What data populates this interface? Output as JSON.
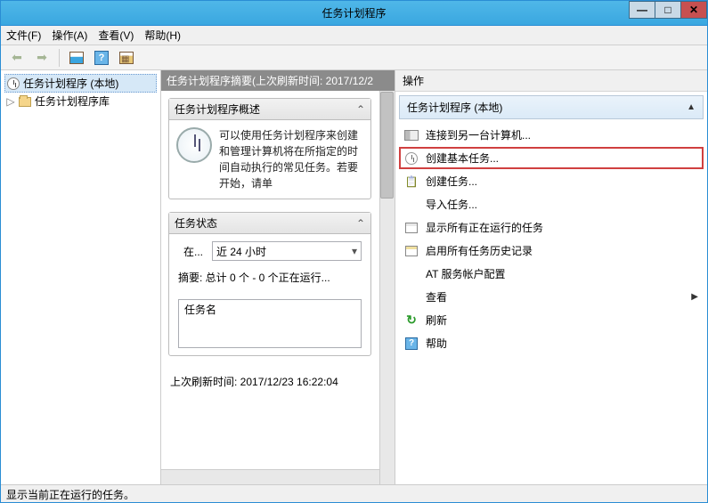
{
  "window": {
    "title": "任务计划程序"
  },
  "menu": {
    "file": "文件(F)",
    "action": "操作(A)",
    "view": "查看(V)",
    "help": "帮助(H)"
  },
  "tree": {
    "root": "任务计划程序 (本地)",
    "lib": "任务计划程序库"
  },
  "mid": {
    "header": "任务计划程序摘要(上次刷新时间: 2017/12/2",
    "overview_title": "任务计划程序概述",
    "overview_text": "可以使用任务计划程序来创建和管理计算机将在所指定的时间自动执行的常见任务。若要开始，请单",
    "status_title": "任务状态",
    "status_label": "在...",
    "status_period": "近 24 小时",
    "status_summary": "摘要: 总计 0 个 - 0 个正在运行...",
    "task_col": "任务名",
    "last_refresh": "上次刷新时间: 2017/12/23 16:22:04"
  },
  "actions": {
    "header": "操作",
    "title": "任务计划程序 (本地)",
    "items": {
      "connect": "连接到另一台计算机...",
      "basic": "创建基本任务...",
      "create": "创建任务...",
      "import": "导入任务...",
      "show_running": "显示所有正在运行的任务",
      "enable_history": "启用所有任务历史记录",
      "at_config": "AT 服务帐户配置",
      "view": "查看",
      "refresh": "刷新",
      "help": "帮助"
    }
  },
  "statusbar": "显示当前正在运行的任务。"
}
